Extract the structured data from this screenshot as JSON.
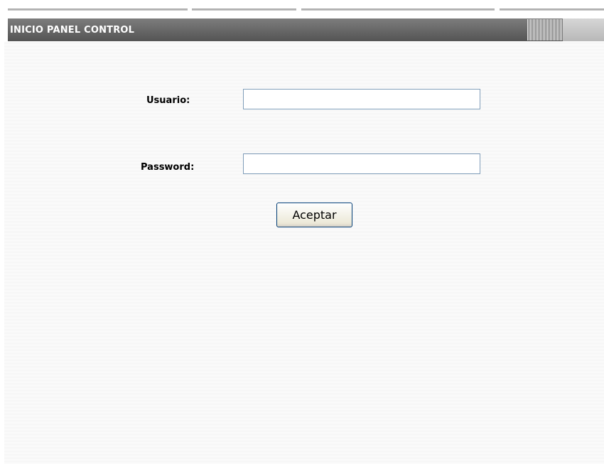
{
  "header": {
    "title": "INICIO PANEL CONTROL"
  },
  "login_form": {
    "username_label": "Usuario:",
    "username_value": "",
    "password_label": "Password:",
    "password_value": "",
    "submit_label": "Aceptar"
  },
  "colors": {
    "header_background": "#5f5f5f",
    "header_text": "#ffffff",
    "input_border": "#7f9db9",
    "button_face": "#ece9d8"
  }
}
